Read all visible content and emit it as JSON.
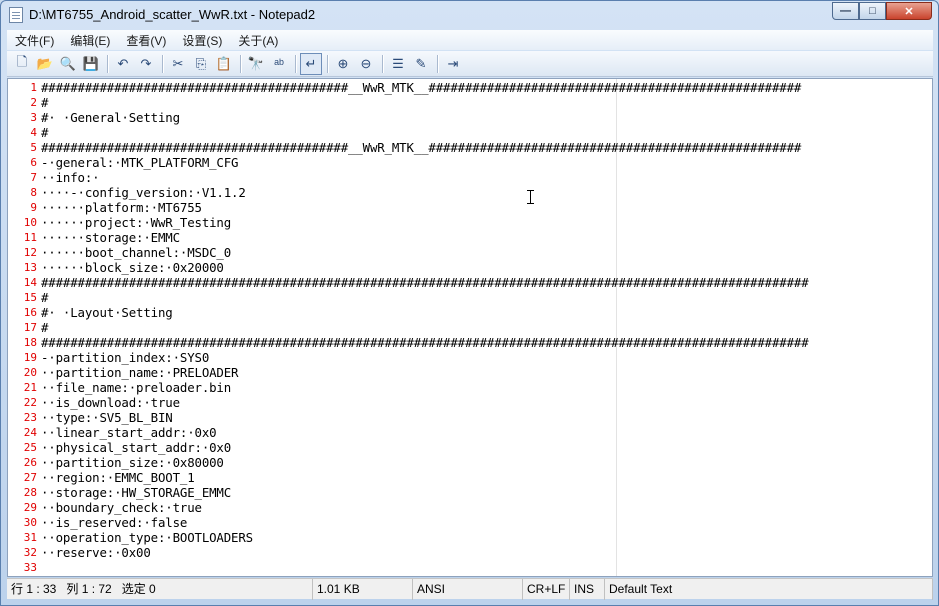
{
  "window": {
    "title": "D:\\MT6755_Android_scatter_WwR.txt - Notepad2",
    "controls": {
      "minimize": "—",
      "maximize": "□",
      "close": "✕"
    }
  },
  "menu": [
    "文件(F)",
    "编辑(E)",
    "查看(V)",
    "设置(S)",
    "关于(A)"
  ],
  "toolbar": {
    "icons": [
      "new-file-icon",
      "open-file-icon",
      "browse-icon",
      "save-icon",
      "undo-icon",
      "redo-icon",
      "cut-icon",
      "copy-icon",
      "paste-icon",
      "find-icon",
      "replace-icon",
      "word-wrap-icon",
      "zoom-in-icon",
      "zoom-out-icon",
      "scheme-icon",
      "customize-icon",
      "exit-icon"
    ],
    "glyphs": [
      "🗋",
      "📂",
      "🔍",
      "💾",
      "↶",
      "↷",
      "✂",
      "⎘",
      "📋",
      "🔭",
      "ᵃᵇ",
      "↵",
      "⊕",
      "⊖",
      "☰",
      "✎",
      "⇥"
    ]
  },
  "editor": {
    "lines": [
      {
        "n": "1",
        "t": "##########################################__WwR_MTK__###################################################"
      },
      {
        "n": "2",
        "t": "#"
      },
      {
        "n": "3",
        "t": "#· ·General·Setting"
      },
      {
        "n": "4",
        "t": "#"
      },
      {
        "n": "5",
        "t": "##########################################__WwR_MTK__###################################################"
      },
      {
        "n": "6",
        "t": "-·general:·MTK_PLATFORM_CFG"
      },
      {
        "n": "7",
        "t": "··info:·"
      },
      {
        "n": "8",
        "t": "····-·config_version:·V1.1.2"
      },
      {
        "n": "9",
        "t": "······platform:·MT6755"
      },
      {
        "n": "10",
        "t": "······project:·WwR_Testing"
      },
      {
        "n": "11",
        "t": "······storage:·EMMC"
      },
      {
        "n": "12",
        "t": "······boot_channel:·MSDC_0"
      },
      {
        "n": "13",
        "t": "······block_size:·0x20000"
      },
      {
        "n": "14",
        "t": "#########################################################################################################"
      },
      {
        "n": "15",
        "t": "#"
      },
      {
        "n": "16",
        "t": "#· ·Layout·Setting"
      },
      {
        "n": "17",
        "t": "#"
      },
      {
        "n": "18",
        "t": "#########################################################################################################"
      },
      {
        "n": "19",
        "t": "-·partition_index:·SYS0"
      },
      {
        "n": "20",
        "t": "··partition_name:·PRELOADER"
      },
      {
        "n": "21",
        "t": "··file_name:·preloader.bin"
      },
      {
        "n": "22",
        "t": "··is_download:·true"
      },
      {
        "n": "23",
        "t": "··type:·SV5_BL_BIN"
      },
      {
        "n": "24",
        "t": "··linear_start_addr:·0x0"
      },
      {
        "n": "25",
        "t": "··physical_start_addr:·0x0"
      },
      {
        "n": "26",
        "t": "··partition_size:·0x80000"
      },
      {
        "n": "27",
        "t": "··region:·EMMC_BOOT_1"
      },
      {
        "n": "28",
        "t": "··storage:·HW_STORAGE_EMMC"
      },
      {
        "n": "29",
        "t": "··boundary_check:·true"
      },
      {
        "n": "30",
        "t": "··is_reserved:·false"
      },
      {
        "n": "31",
        "t": "··operation_type:·BOOTLOADERS"
      },
      {
        "n": "32",
        "t": "··reserve:·0x00"
      },
      {
        "n": "33",
        "t": ""
      }
    ]
  },
  "status": {
    "position": "行 1 : 33   列 1 : 72   选定 0",
    "size": "1.01 KB",
    "encoding": "ANSI",
    "line_ending": "CR+LF",
    "mode": "INS",
    "scheme": "Default Text"
  }
}
